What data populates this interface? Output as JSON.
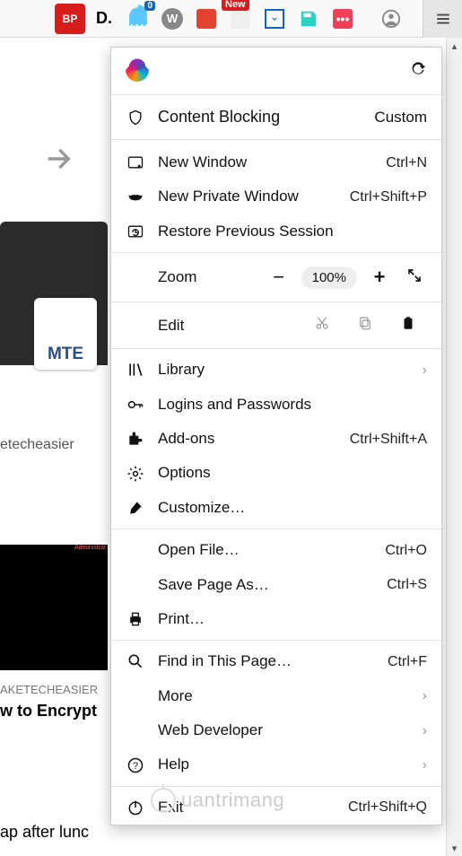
{
  "toolbar": {
    "icons": [
      {
        "name": "adblock",
        "text": "BP",
        "bg": "#d81b1b",
        "fg": "#fff"
      },
      {
        "name": "duck",
        "text": "D.",
        "bg": "transparent",
        "fg": "#111"
      },
      {
        "name": "ghost",
        "text": "",
        "badge": "0"
      },
      {
        "name": "wallabag",
        "text": "W",
        "bg": "#888",
        "fg": "#fff",
        "round": true
      },
      {
        "name": "todoist",
        "text": "",
        "bg": "#e44332"
      },
      {
        "name": "new-ext",
        "text": "",
        "badge_new": "New"
      },
      {
        "name": "download",
        "text": "",
        "bg": "#fff",
        "border": "#1565c0"
      },
      {
        "name": "save",
        "text": "",
        "bg": "#29d3c4"
      },
      {
        "name": "pocket",
        "text": "•••",
        "bg": "#ee4056",
        "fg": "#fff"
      },
      {
        "name": "account",
        "text": ""
      }
    ]
  },
  "page": {
    "card1_label": "etecheasier",
    "card1_badge": "MTE",
    "card2_kicker": "AKETECHEASIER",
    "card2_title": "w to Encrypt",
    "card3_line": "ap after lunc"
  },
  "menu": {
    "sync": "",
    "content_blocking": {
      "label": "Content Blocking",
      "mode": "Custom"
    },
    "new_window": {
      "label": "New Window",
      "shortcut": "Ctrl+N"
    },
    "new_private": {
      "label": "New Private Window",
      "shortcut": "Ctrl+Shift+P"
    },
    "restore": {
      "label": "Restore Previous Session"
    },
    "zoom": {
      "label": "Zoom",
      "value": "100%"
    },
    "edit": {
      "label": "Edit"
    },
    "library": {
      "label": "Library"
    },
    "logins": {
      "label": "Logins and Passwords"
    },
    "addons": {
      "label": "Add-ons",
      "shortcut": "Ctrl+Shift+A"
    },
    "options": {
      "label": "Options"
    },
    "customize": {
      "label": "Customize…"
    },
    "open_file": {
      "label": "Open File…",
      "shortcut": "Ctrl+O"
    },
    "save_as": {
      "label": "Save Page As…",
      "shortcut": "Ctrl+S"
    },
    "print": {
      "label": "Print…"
    },
    "find": {
      "label": "Find in This Page…",
      "shortcut": "Ctrl+F"
    },
    "more": {
      "label": "More"
    },
    "webdev": {
      "label": "Web Developer"
    },
    "help": {
      "label": "Help"
    },
    "exit": {
      "label": "Exit",
      "shortcut": "Ctrl+Shift+Q"
    }
  },
  "watermark": "uantrimang"
}
